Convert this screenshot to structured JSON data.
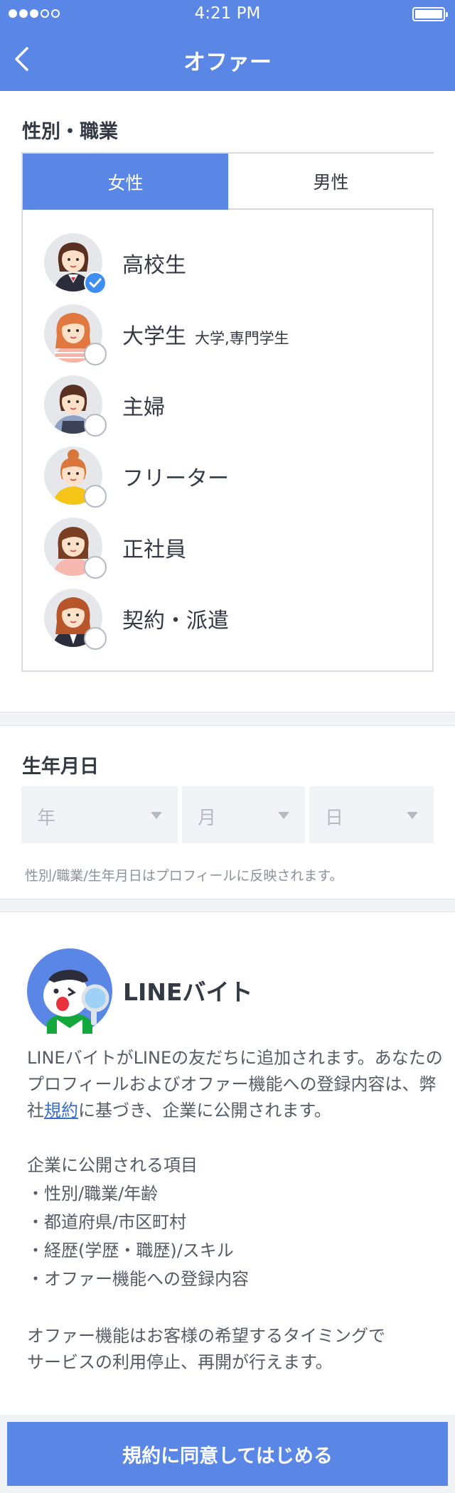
{
  "status": {
    "time": "4:21 PM"
  },
  "nav": {
    "title": "オファー"
  },
  "section_gender": {
    "title": "性別・職業",
    "tabs": [
      "女性",
      "男性"
    ],
    "selected_tab": "女性",
    "occupations": [
      {
        "label": "高校生",
        "sub": "",
        "checked": true
      },
      {
        "label": "大学生",
        "sub": "大学,専門学生",
        "checked": false
      },
      {
        "label": "主婦",
        "sub": "",
        "checked": false
      },
      {
        "label": "フリーター",
        "sub": "",
        "checked": false
      },
      {
        "label": "正社員",
        "sub": "",
        "checked": false
      },
      {
        "label": "契約・派遣",
        "sub": "",
        "checked": false
      }
    ]
  },
  "section_birth": {
    "title": "生年月日",
    "year": "年",
    "month": "月",
    "day": "日",
    "hint": "性別/職業/生年月日はプロフィールに反映されます。"
  },
  "section_line": {
    "title": "LINEバイト",
    "para1_a": "LINEバイトがLINEの友だちに追加されます。あなたのプロフィールおよびオファー機能への登録内容は、弊社",
    "para1_link": "規約",
    "para1_b": "に基づき、企業に公開されます。",
    "items_heading": "企業に公開される項目",
    "items": [
      "・性別/職業/年齢",
      "・都道府県/市区町村",
      "・経歴(学歴・職歴)/スキル",
      "・オファー機能への登録内容"
    ],
    "para3_line1": "オファー機能はお客様の希望するタイミングで",
    "para3_line2": "サービスの利用停止、再開が行えます。"
  },
  "cta": {
    "label": "規約に同意してはじめる"
  },
  "colors": {
    "brand_blue": "#5a87e6",
    "check_blue": "#3d8ef0",
    "line_green": "#00b900"
  }
}
